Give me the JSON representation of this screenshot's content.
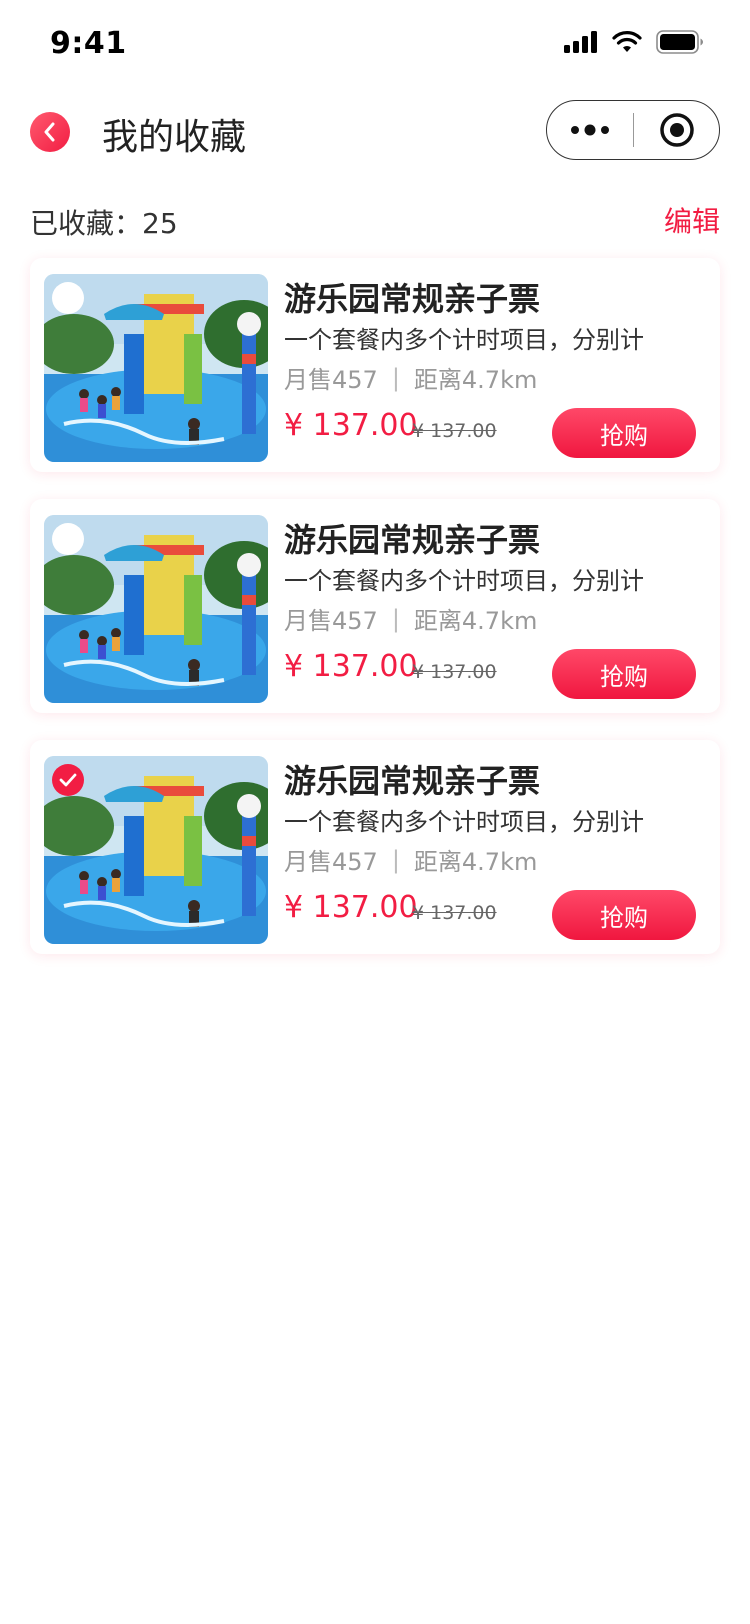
{
  "status_bar": {
    "time": "9:41"
  },
  "header": {
    "title": "我的收藏"
  },
  "summary": {
    "count_text": "已收藏：25",
    "edit_label": "编辑"
  },
  "items": [
    {
      "title": "游乐园常规亲子票",
      "desc": "一个套餐内多个计时项目，分别计",
      "sales": "月售457",
      "distance": "距离4.7km",
      "price": "¥ 137.00",
      "original_price": "¥ 137.00",
      "buy_label": "抢购",
      "selected": false
    },
    {
      "title": "游乐园常规亲子票",
      "desc": "一个套餐内多个计时项目，分别计",
      "sales": "月售457",
      "distance": "距离4.7km",
      "price": "¥ 137.00",
      "original_price": "¥ 137.00",
      "buy_label": "抢购",
      "selected": false
    },
    {
      "title": "游乐园常规亲子票",
      "desc": "一个套餐内多个计时项目，分别计",
      "sales": "月售457",
      "distance": "距离4.7km",
      "price": "¥ 137.00",
      "original_price": "¥ 137.00",
      "buy_label": "抢购",
      "selected": true
    }
  ],
  "colors": {
    "accent": "#f21d43",
    "muted": "#999999"
  },
  "icons": {
    "back": "chevron-left-icon",
    "more": "more-dots-icon",
    "target": "target-icon",
    "check": "checkmark-icon"
  }
}
